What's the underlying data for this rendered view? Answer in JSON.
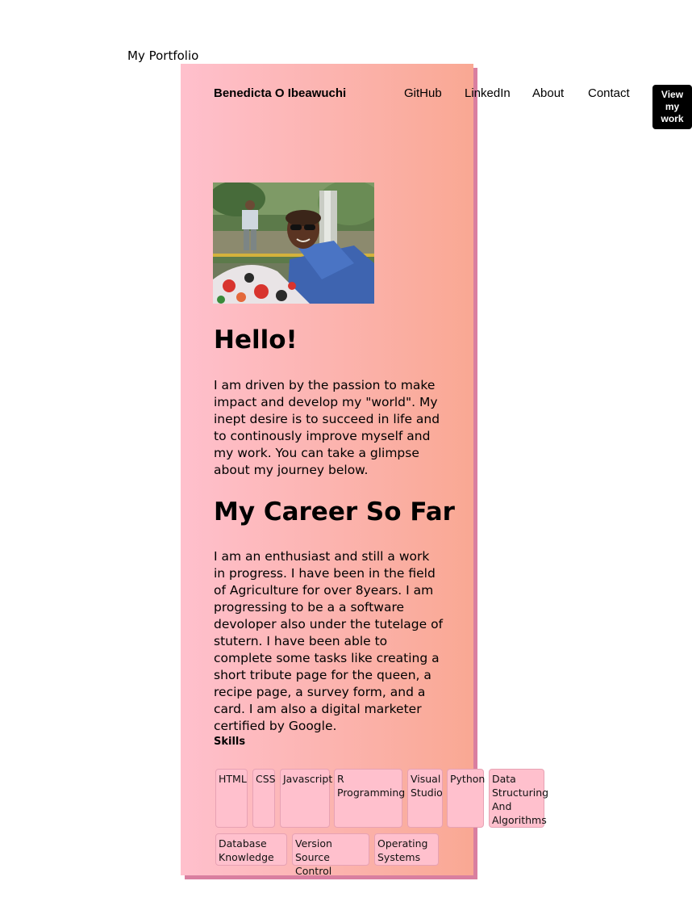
{
  "page": {
    "title": "My Portfolio"
  },
  "header": {
    "brand": "Benedicta O Ibeawuchi",
    "nav": [
      "GitHub",
      "LinkedIn",
      "About",
      "Contact"
    ],
    "cta": "View my work"
  },
  "intro": {
    "heading": "Hello!",
    "text": "I am driven by the passion to make impact and develop my \"world\". My inept desire is to succeed in life and to continously improve myself and my work. You can take a glimpse about my journey below."
  },
  "career": {
    "heading": "My Career So Far",
    "text": "I am an enthusiast and still a work in progress. I have been in the field of Agriculture for over 8years. I am progressing to be a a software devoloper also under the tutelage of stutern. I have been able to complete some tasks like creating a short tribute page for the queen, a recipe page, a survey form, and a card. I am also a digital marketer certified by Google."
  },
  "skills": {
    "label": "Skills",
    "items": [
      "HTML",
      "CSS",
      "Javascript",
      "R Programming",
      "Visual Studio",
      "Python",
      "Data Structuring And Algorithms",
      "Database Knowledge",
      "Version Source Control",
      "Operating Systems"
    ]
  },
  "colors": {
    "card_gradient_start": "#ffc0cd",
    "card_gradient_end": "#f9a893",
    "shadow": "#d97fa0",
    "button_bg": "#000000"
  }
}
